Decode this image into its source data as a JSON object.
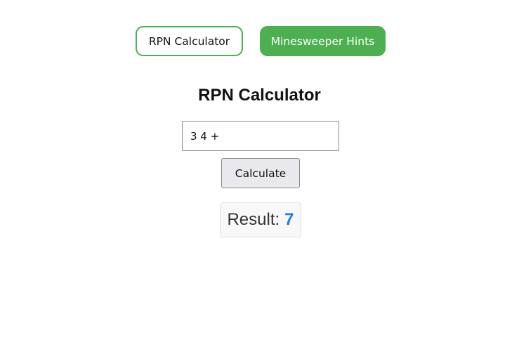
{
  "tabs": [
    {
      "label": "RPN Calculator",
      "active": true
    },
    {
      "label": "Minesweeper Hints",
      "active": false
    }
  ],
  "page": {
    "title": "RPN Calculator"
  },
  "calculator": {
    "expression": "3 4 +",
    "button_label": "Calculate",
    "result_label": "Result:",
    "result_value": "7"
  },
  "colors": {
    "accent": "#4caf50",
    "result_value": "#1a7fe0"
  }
}
